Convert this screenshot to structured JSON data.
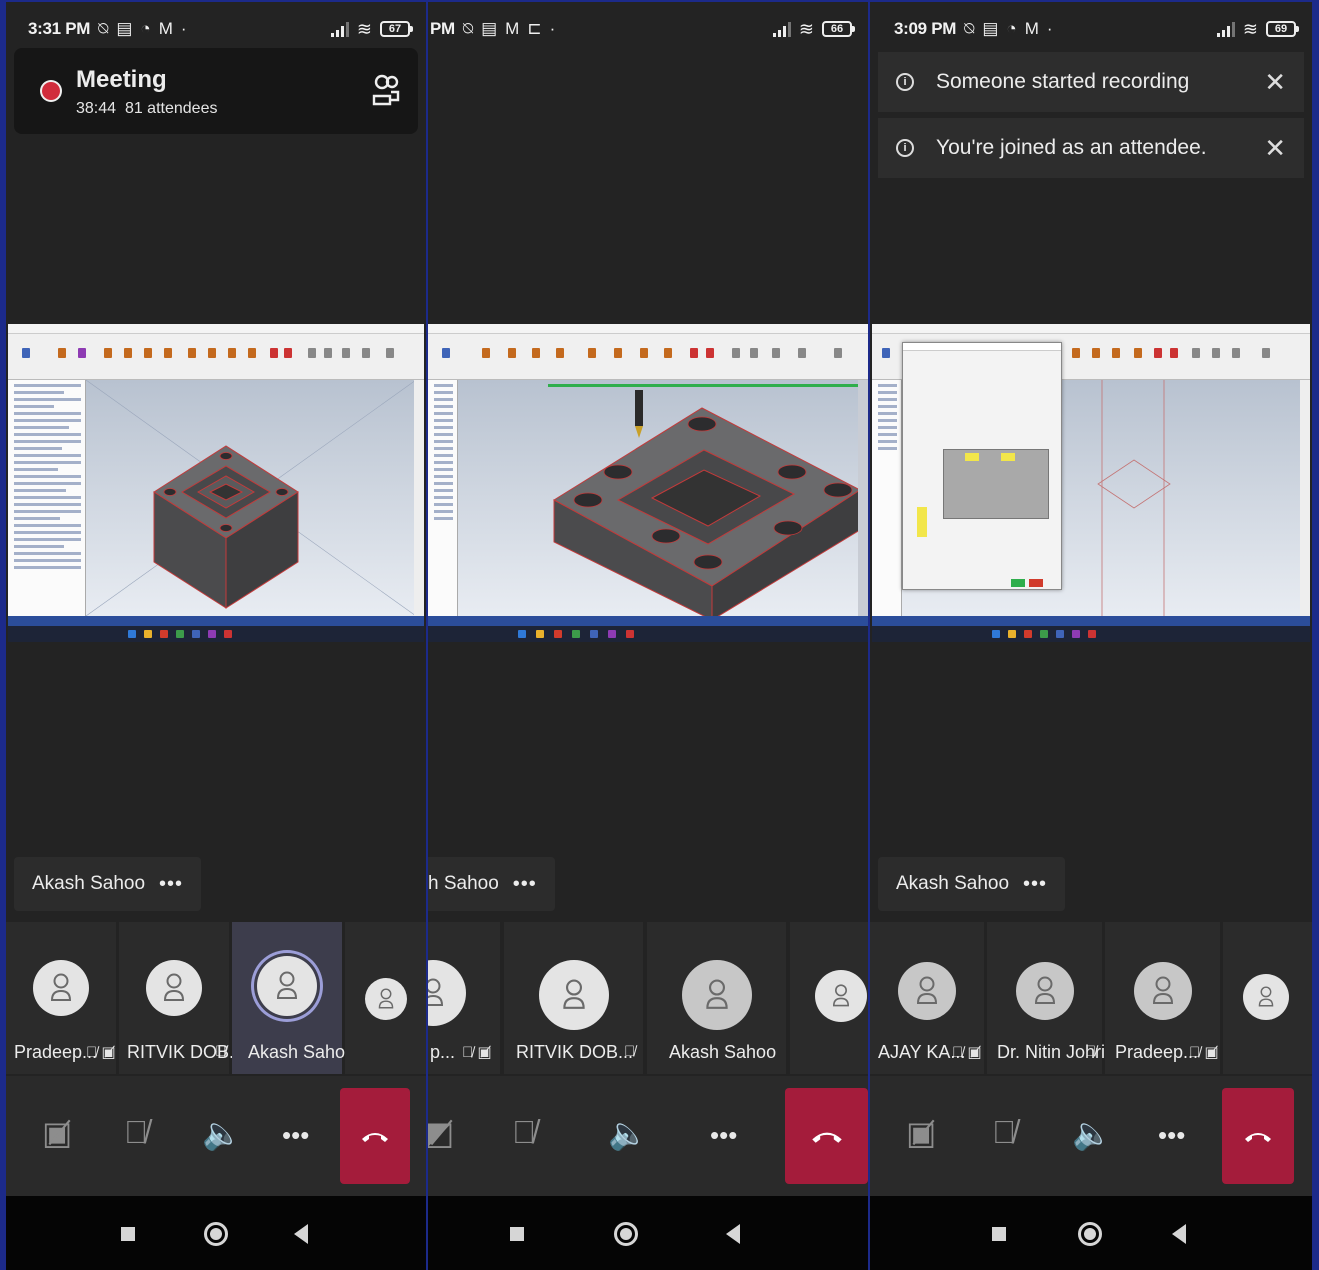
{
  "panels": [
    {
      "status": {
        "time": "3:31 PM",
        "battery": "67"
      },
      "meeting": {
        "title": "Meeting",
        "duration": "38:44",
        "attendees": "81 attendees"
      },
      "presenter": {
        "name": "Akash Sahoo",
        "more": "•••"
      },
      "participants": [
        {
          "name": "Pradeep...",
          "icons": "🎙̸ ▣̸"
        },
        {
          "name": "RITVIK DOB...",
          "icons": "🎙̸"
        },
        {
          "name": "Akash Sahoo",
          "icons": ""
        },
        {
          "name": "",
          "icons": ""
        }
      ]
    },
    {
      "status": {
        "time": "PM",
        "battery": "66"
      },
      "presenter": {
        "name": "h Sahoo",
        "more": "•••"
      },
      "participants": [
        {
          "name": "p...",
          "icons": "🎙̸ ▣̸"
        },
        {
          "name": "RITVIK DOB...",
          "icons": "🎙̸"
        },
        {
          "name": "Akash Sahoo",
          "icons": ""
        },
        {
          "name": "",
          "icons": ""
        }
      ]
    },
    {
      "status": {
        "time": "3:09 PM",
        "battery": "69"
      },
      "notifications": [
        {
          "text": "Someone started recording"
        },
        {
          "text": "You're joined as an attendee."
        }
      ],
      "presenter": {
        "name": "Akash Sahoo",
        "more": "•••"
      },
      "participants": [
        {
          "name": "AJAY KA...",
          "icons": "🎙̸ ▣̸"
        },
        {
          "name": "Dr. Nitin Johri",
          "icons": "🎙̸"
        },
        {
          "name": "Pradeep...",
          "icons": "🎙̸ ▣̸"
        },
        {
          "name": "",
          "icons": ""
        }
      ]
    }
  ],
  "controls": {
    "more_label": "•••"
  },
  "icons": {
    "status": [
      "mute-notification-icon",
      "message-icon",
      "whatsapp-icon",
      "gmail-icon"
    ],
    "controls": [
      "camera-off-icon",
      "mic-off-icon",
      "speaker-icon",
      "more-icon",
      "hang-up-icon"
    ]
  },
  "colors": {
    "hangup": "#a41c3b",
    "record": "#d12c3c",
    "active_tile": "#3d3d4c",
    "accent_ring": "#9c9ed8"
  }
}
